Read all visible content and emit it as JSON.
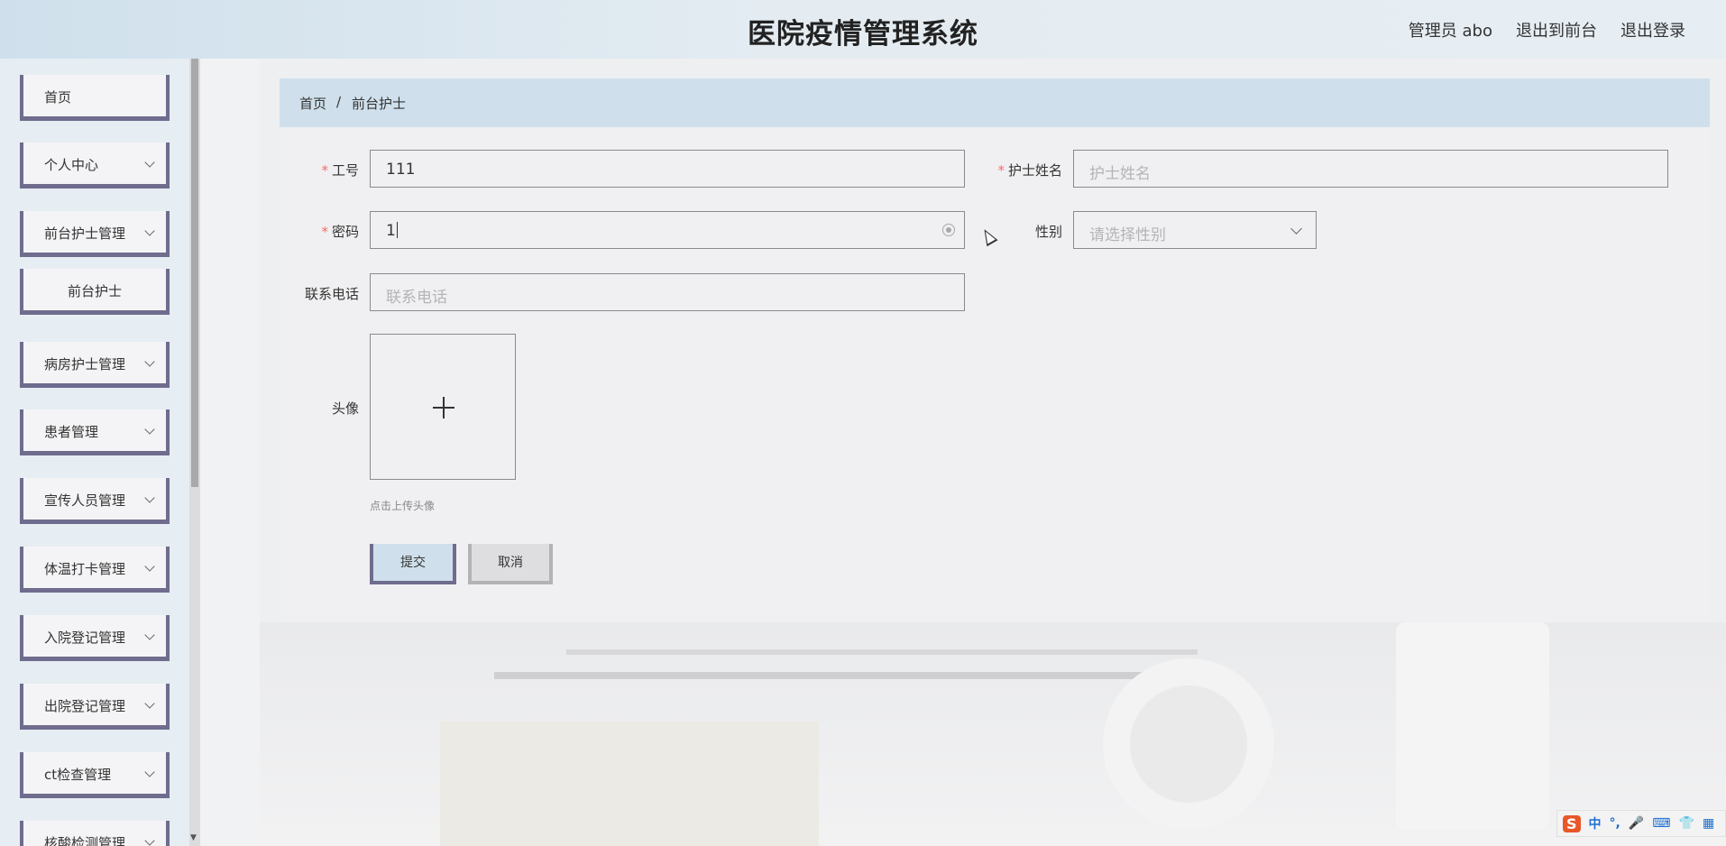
{
  "header": {
    "title": "医院疫情管理系统",
    "user_label": "管理员 abo",
    "back_front_label": "退出到前台",
    "logout_label": "退出登录"
  },
  "sidebar": {
    "items": [
      {
        "label": "首页"
      },
      {
        "label": "个人中心"
      },
      {
        "label": "前台护士管理"
      },
      {
        "label": "前台护士"
      },
      {
        "label": "病房护士管理"
      },
      {
        "label": "患者管理"
      },
      {
        "label": "宣传人员管理"
      },
      {
        "label": "体温打卡管理"
      },
      {
        "label": "入院登记管理"
      },
      {
        "label": "出院登记管理"
      },
      {
        "label": "ct检查管理"
      },
      {
        "label": "核酸检测管理"
      }
    ]
  },
  "breadcrumb": {
    "home": "首页",
    "separator": "/",
    "current": "前台护士"
  },
  "form": {
    "job_no": {
      "label": "工号",
      "value": "111"
    },
    "name": {
      "label": "护士姓名",
      "placeholder": "护士姓名"
    },
    "password": {
      "label": "密码",
      "value": "1"
    },
    "gender": {
      "label": "性别",
      "placeholder": "请选择性别"
    },
    "phone": {
      "label": "联系电话",
      "placeholder": "联系电话"
    },
    "avatar": {
      "label": "头像",
      "hint": "点击上传头像"
    },
    "submit_label": "提交",
    "cancel_label": "取消"
  },
  "ime": {
    "logo": "S",
    "mode": "中",
    "punct": "°,"
  },
  "colors": {
    "accent": "#cfe0ec",
    "menu_border": "#6f6c8e",
    "required": "#f56c6c"
  }
}
